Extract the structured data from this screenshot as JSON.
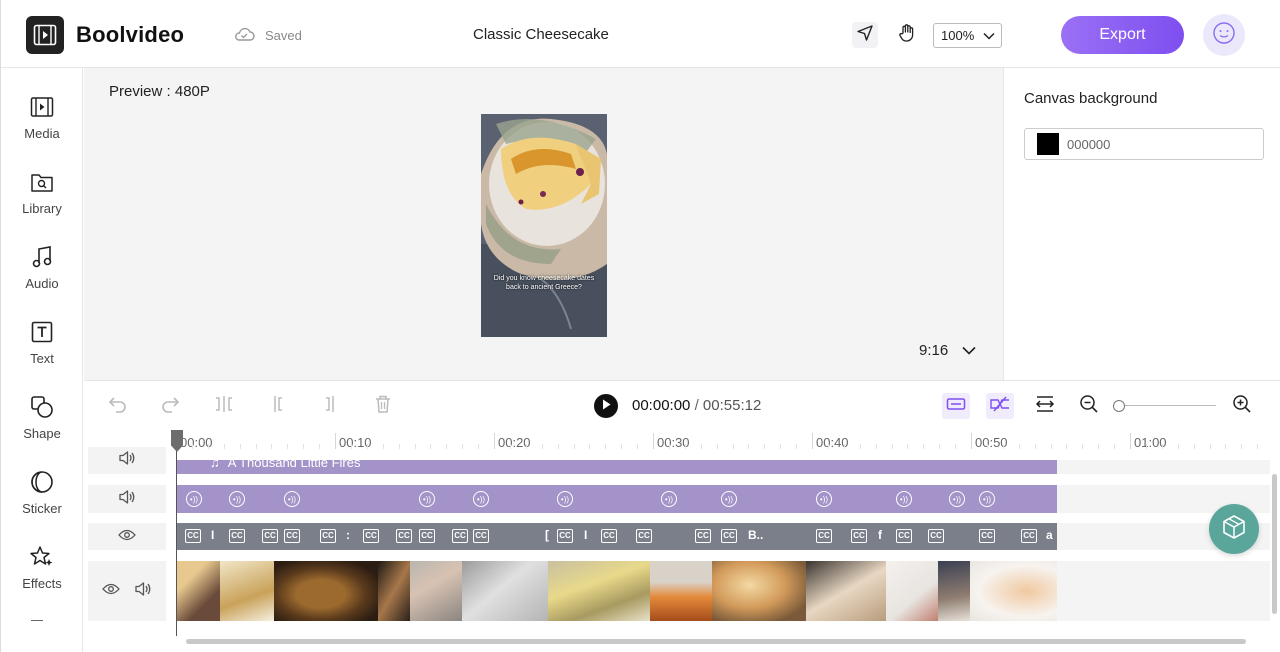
{
  "header": {
    "brand": "Boolvideo",
    "save_status": "Saved",
    "project_title": "Classic Cheesecake",
    "zoom_level": "100%",
    "export_label": "Export"
  },
  "sidebar": {
    "items": [
      {
        "label": "Media",
        "icon": "media-icon"
      },
      {
        "label": "Library",
        "icon": "library-icon"
      },
      {
        "label": "Audio",
        "icon": "music-note-icon"
      },
      {
        "label": "Text",
        "icon": "text-icon"
      },
      {
        "label": "Shape",
        "icon": "shape-icon"
      },
      {
        "label": "Sticker",
        "icon": "sticker-icon"
      },
      {
        "label": "Effects",
        "icon": "effects-icon"
      }
    ]
  },
  "preview": {
    "label": "Preview : 480P",
    "caption": "Did you know cheesecake dates back to ancient Greece?",
    "aspect_ratio": "9:16"
  },
  "canvas_panel": {
    "title": "Canvas background",
    "color_value": "000000",
    "color_hex": "#000000"
  },
  "playback": {
    "current_time": "00:00:00",
    "separator": "/",
    "duration": "00:55:12"
  },
  "timeline": {
    "ruler_labels": [
      "00:00",
      "00:10",
      "00:20",
      "00:30",
      "00:40",
      "00:50",
      "01:00"
    ],
    "audio_track_title": "A Thousand Little Fires",
    "caption_snippets": [
      "I",
      ":",
      "[",
      "I",
      "B..",
      "f",
      "a"
    ],
    "colors": {
      "music_track": "#a493c8",
      "caption_track": "#7a7f8a",
      "accent": "#7e4ff0",
      "help_button": "#5ba69a"
    }
  }
}
